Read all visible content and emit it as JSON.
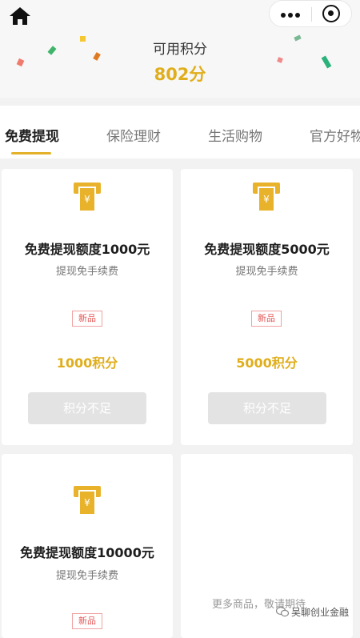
{
  "header": {
    "points_label": "可用积分",
    "points_value": "802分",
    "icons": {
      "home": "home-icon",
      "more": "more-dots-icon",
      "close": "target-circle-icon"
    }
  },
  "tabs": [
    {
      "label": "免费提现",
      "active": true
    },
    {
      "label": "保险理财",
      "active": false
    },
    {
      "label": "生活购物",
      "active": false
    },
    {
      "label": "官方好物",
      "active": false
    }
  ],
  "products": [
    {
      "title": "免费提现额度1000元",
      "subtitle": "提现免手续费",
      "badge": "新品",
      "price": "1000积分",
      "button": "积分不足"
    },
    {
      "title": "免费提现额度5000元",
      "subtitle": "提现免手续费",
      "badge": "新品",
      "price": "5000积分",
      "button": "积分不足"
    },
    {
      "title": "免费提现额度10000元",
      "subtitle": "提现免手续费",
      "badge": "新品"
    }
  ],
  "more_text": "更多商品，敬请期待",
  "watermark": "吴聊创业金融",
  "colors": {
    "accent": "#e0ae1c",
    "badge": "#e35757",
    "disabled": "#e3e3e3"
  }
}
